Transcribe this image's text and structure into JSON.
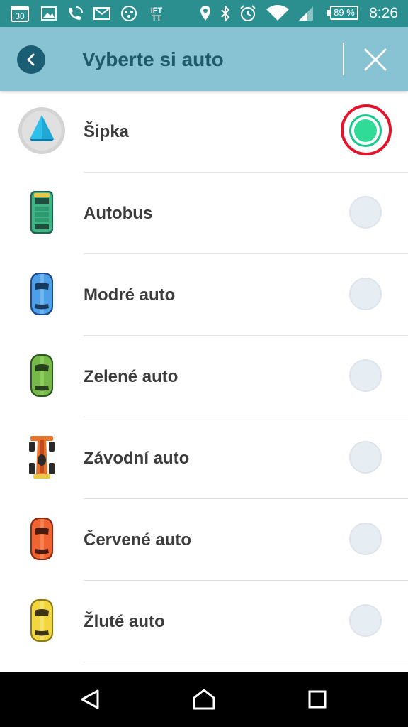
{
  "status_bar": {
    "time": "8:26",
    "battery": "89 %",
    "notification_badge": "30",
    "ifttt": "IFTTT",
    "icons": [
      "calendar-icon",
      "image-icon",
      "wifi-calling-icon",
      "gmail-icon",
      "app-dots-icon",
      "ifttt-icon",
      "location-icon",
      "bluetooth-icon",
      "alarm-icon",
      "wifi-icon",
      "signal-icon",
      "battery-icon"
    ]
  },
  "header": {
    "title": "Vyberte si auto",
    "back_icon": "back-arrow-icon",
    "close_icon": "close-icon",
    "colors": {
      "bar": "#88c3d3",
      "title": "#1e5a6c"
    }
  },
  "cars": [
    {
      "label": "Šipka",
      "icon": "arrow-icon",
      "selected": true
    },
    {
      "label": "Autobus",
      "icon": "bus-icon",
      "selected": false
    },
    {
      "label": "Modré auto",
      "icon": "blue-car-icon",
      "selected": false
    },
    {
      "label": "Zelené auto",
      "icon": "green-car-icon",
      "selected": false
    },
    {
      "label": "Závodní auto",
      "icon": "race-car-icon",
      "selected": false
    },
    {
      "label": "Červené auto",
      "icon": "red-car-icon",
      "selected": false
    },
    {
      "label": "Žluté auto",
      "icon": "yellow-car-icon",
      "selected": false
    }
  ],
  "selection_color": "#2fdb97",
  "highlight_color": "#e3132a",
  "nav_bar": {
    "buttons": [
      "back-icon",
      "home-icon",
      "recents-icon"
    ]
  }
}
